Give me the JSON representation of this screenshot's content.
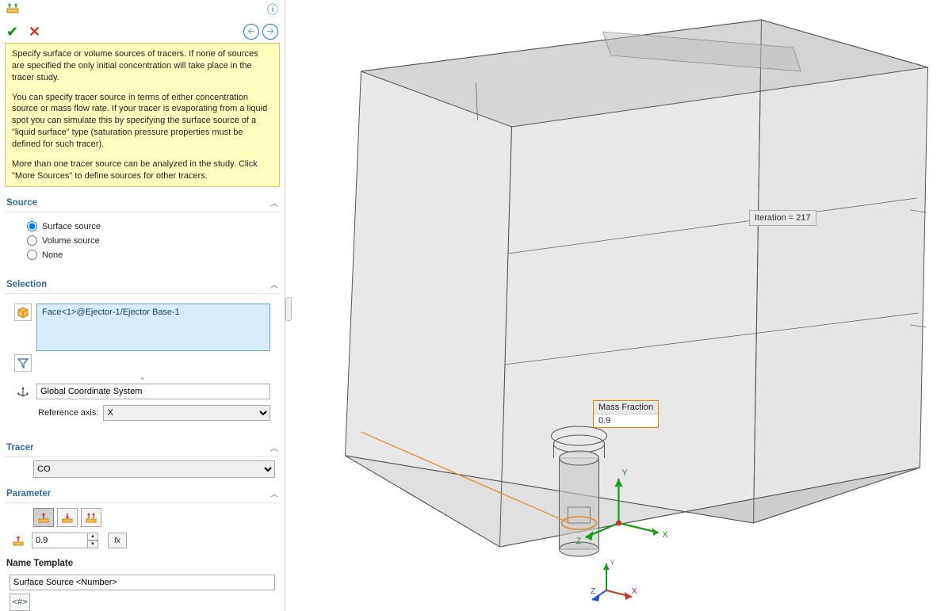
{
  "info": {
    "p1": "Specify surface or volume sources of tracers. If none of sources are specified the only initial concentration will take place in the tracer study.",
    "p2": "You can specify tracer source in terms of either concentration source or mass flow rate. If your tracer is evaporating from a liquid spot you can simulate this by specifying the surface source of a \"liquid surface\" type (saturation pressure properties must be defined for such tracer).",
    "p3": "More than one tracer source can be analyzed in the study. Click \"More Sources\" to define sources for other tracers."
  },
  "source": {
    "title": "Source",
    "options": {
      "surface": "Surface source",
      "volume": "Volume source",
      "none": "None"
    },
    "selected": "surface"
  },
  "selection": {
    "title": "Selection",
    "face": "Face<1>@Ejector-1/Ejector Base-1",
    "coord_system": "Global Coordinate System",
    "axis_label": "Reference axis:",
    "axis_value": "X"
  },
  "tracer": {
    "title": "Tracer",
    "value": "CO"
  },
  "parameter": {
    "title": "Parameter",
    "value": "0.9",
    "fx": "fx"
  },
  "name_template": {
    "title": "Name Template",
    "value": "Surface Source <Number>",
    "hash": "<#>"
  },
  "viewport": {
    "iteration_label": "Iteration = 217",
    "mass_fraction_label": "Mass Fraction",
    "mass_fraction_value": "0.9",
    "axes": {
      "x": "X",
      "y": "Y",
      "z": "Z"
    }
  }
}
